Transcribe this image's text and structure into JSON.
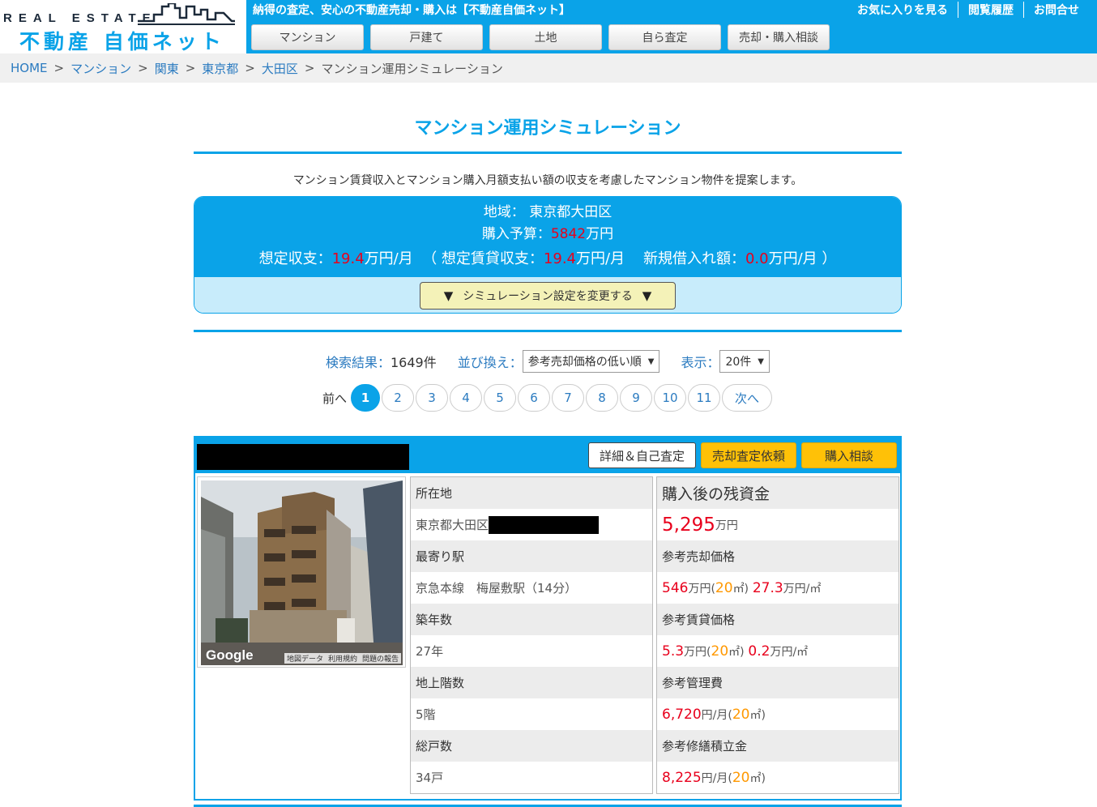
{
  "header": {
    "logo_en": "REAL ESTATE",
    "logo_jp": "不動産 自価ネット",
    "tagline": "納得の査定、安心の不動産売却・購入は【不動産自価ネット】",
    "top_links": [
      "お気に入りを見る",
      "閲覧履歴",
      "お問合せ"
    ],
    "nav": [
      "マンション",
      "戸建て",
      "土地",
      "自ら査定",
      "売却・購入相談"
    ],
    "accent_color": "#0aa3e8"
  },
  "breadcrumb": {
    "items": [
      "HOME",
      "マンション",
      "関東",
      "東京都",
      "大田区"
    ],
    "separator": ">",
    "current": "マンション運用シミュレーション"
  },
  "page": {
    "title": "マンション運用シミュレーション",
    "intro": "マンション賃貸収入とマンション購入月額支払い額の収支を考慮したマンション物件を提案します。"
  },
  "simulation": {
    "region_label": "地域：",
    "region_value": "東京都大田区",
    "budget_label": "購入予算：",
    "budget_value": "5842",
    "budget_unit": "万円",
    "balance_label": "想定収支：",
    "balance_value": "19.4",
    "balance_unit": "万円/月",
    "rental_label": "（ 想定賃貸収支：",
    "rental_value": "19.4",
    "rental_unit": "万円/月",
    "loan_label": "新規借入れ額：",
    "loan_value": "0.0",
    "loan_unit": "万円/月 ）",
    "toggle_button": "シミュレーション設定を変更する",
    "toggle_icon": "▼"
  },
  "results": {
    "count_label": "検索結果：",
    "count_value": "1649件",
    "sort_label": "並び換え：",
    "sort_selected": "参考売却価格の低い順",
    "display_label": "表示：",
    "display_selected": "20件",
    "select_arrow": "▼"
  },
  "pager": {
    "prev": "前へ",
    "pages": [
      "1",
      "2",
      "3",
      "4",
      "5",
      "6",
      "7",
      "8",
      "9",
      "10",
      "11"
    ],
    "active": "1",
    "next": "次へ"
  },
  "listing": {
    "buttons": {
      "detail": "詳細＆自己査定",
      "sell": "売却査定依頼",
      "buy": "購入相談"
    },
    "photo": {
      "brand": "Google",
      "links": [
        "地図データ",
        "利用規約",
        "問題の報告"
      ]
    },
    "details": {
      "location_label": "所在地",
      "location_value": "東京都大田区",
      "station_label": "最寄り駅",
      "station_value": "京急本線　梅屋敷駅（14分）",
      "age_label": "築年数",
      "age_value": "27年",
      "floors_label": "地上階数",
      "floors_value": "5階",
      "units_label": "総戸数",
      "units_value": "34戸"
    },
    "finance": {
      "remaining_label": "購入後の残資金",
      "remaining_value": "5,295",
      "remaining_unit": "万円",
      "sale_label": "参考売却価格",
      "sale_value": "546",
      "sale_unit": "万円(",
      "sale_area": "20",
      "sale_area_unit": " ㎡)",
      "sale_per_sqm": "27.3",
      "sale_per_sqm_unit": "万円/㎡",
      "rent_label": "参考賃貸価格",
      "rent_value": "5.3",
      "rent_unit": "万円(",
      "rent_area": "20",
      "rent_area_unit": " ㎡)",
      "rent_per_sqm": "0.2",
      "rent_per_sqm_unit": "万円/㎡",
      "mgmt_label": "参考管理費",
      "mgmt_value": "6,720",
      "mgmt_unit": "円/月(",
      "mgmt_area": "20",
      "mgmt_area_unit": " ㎡)",
      "repair_label": "参考修繕積立金",
      "repair_value": "8,225",
      "repair_unit": "円/月(",
      "repair_area": "20",
      "repair_area_unit": " ㎡)"
    }
  }
}
